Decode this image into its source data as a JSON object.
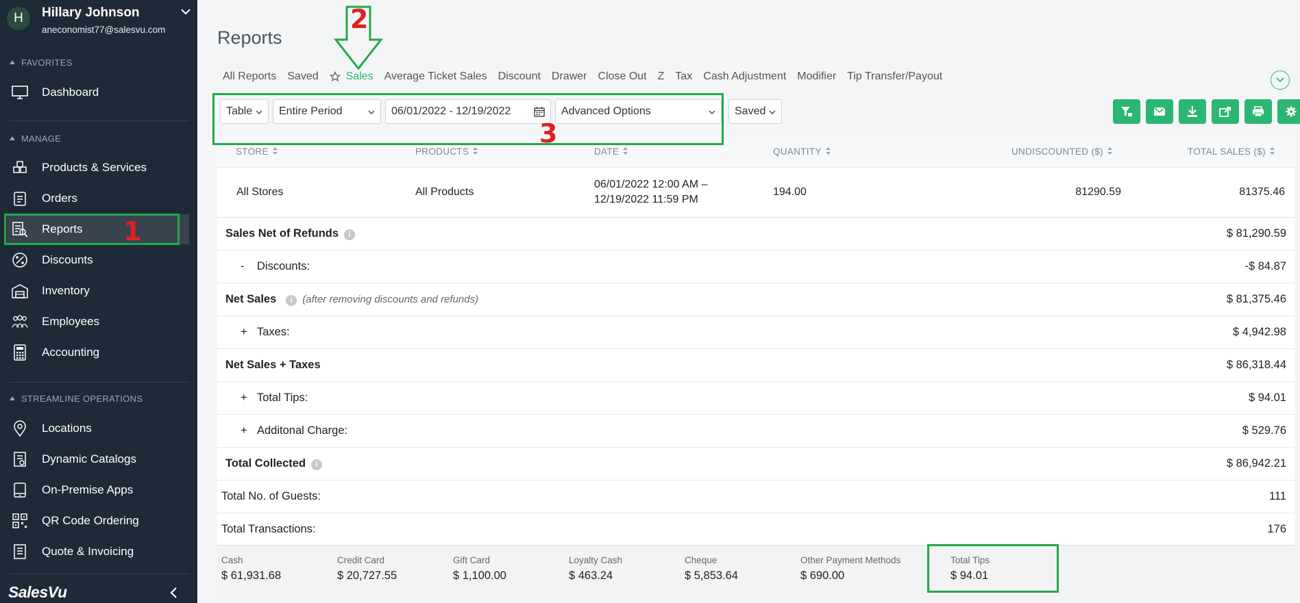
{
  "user": {
    "initial": "H",
    "name": "Hillary Johnson",
    "email": "aneconomist77@salesvu.com"
  },
  "sidebar": {
    "sections": {
      "favorites": "FAVORITES",
      "manage": "MANAGE",
      "streamline": "STREAMLINE OPERATIONS"
    },
    "favorites": [
      {
        "label": "Dashboard",
        "icon": "monitor-icon"
      }
    ],
    "manage": [
      {
        "label": "Products & Services",
        "icon": "boxes-icon"
      },
      {
        "label": "Orders",
        "icon": "clipboard-icon"
      },
      {
        "label": "Reports",
        "icon": "report-icon"
      },
      {
        "label": "Discounts",
        "icon": "percent-icon"
      },
      {
        "label": "Inventory",
        "icon": "warehouse-icon"
      },
      {
        "label": "Employees",
        "icon": "people-icon"
      },
      {
        "label": "Accounting",
        "icon": "calculator-icon"
      }
    ],
    "streamline": [
      {
        "label": "Locations",
        "icon": "location-pin-icon"
      },
      {
        "label": "Dynamic Catalogs",
        "icon": "catalog-icon"
      },
      {
        "label": "On-Premise Apps",
        "icon": "apps-icon"
      },
      {
        "label": "QR Code Ordering",
        "icon": "qr-code-icon"
      },
      {
        "label": "Quote & Invoicing",
        "icon": "invoice-icon"
      }
    ],
    "brand": "SalesVu"
  },
  "page": {
    "title": "Reports"
  },
  "tabs": [
    "All Reports",
    "Saved",
    "Sales",
    "Average Ticket Sales",
    "Discount",
    "Drawer",
    "Close Out",
    "Z",
    "Tax",
    "Cash Adjustment",
    "Modifier",
    "Tip Transfer/Payout"
  ],
  "active_tab": "Sales",
  "toolbar": {
    "view": "Table",
    "period": "Entire Period",
    "date_range": "06/01/2022 - 12/19/2022",
    "advanced": "Advanced Options",
    "saved": "Saved"
  },
  "actions": [
    "filter-icon",
    "email-icon",
    "download-icon",
    "share-icon",
    "print-icon",
    "settings-icon"
  ],
  "table": {
    "headers": [
      "STORE",
      "PRODUCTS",
      "DATE",
      "QUANTITY",
      "UNDISCOUNTED ($)",
      "TOTAL SALES ($)"
    ],
    "row": {
      "store": "All Stores",
      "products": "All Products",
      "date_line1": "06/01/2022 12:00 AM –",
      "date_line2": "12/19/2022 11:59 PM",
      "quantity": "194.00",
      "undiscounted": "81290.59",
      "total_sales": "81375.46"
    }
  },
  "summary": [
    {
      "label": "Sales Net of Refunds",
      "value": "$ 81,290.59"
    },
    {
      "op": "-",
      "label": "Discounts:",
      "value": "-$ 84.87"
    },
    {
      "label": "Net Sales",
      "note": "(after removing discounts and refunds)",
      "value": "$ 81,375.46"
    },
    {
      "op": "+",
      "label": "Taxes:",
      "value": "$ 4,942.98"
    },
    {
      "label": "Net Sales + Taxes",
      "value": "$ 86,318.44"
    },
    {
      "op": "+",
      "label": "Total Tips:",
      "value": "$ 94.01"
    },
    {
      "op": "+",
      "label": "Additonal Charge:",
      "value": "$ 529.76"
    },
    {
      "label": "Total Collected",
      "value": "$ 86,942.21"
    },
    {
      "label": "Total No. of Guests:",
      "value": "111"
    },
    {
      "label": "Total Transactions:",
      "value": "176"
    }
  ],
  "payments": [
    {
      "label": "Cash",
      "value": "$ 61,931.68"
    },
    {
      "label": "Credit Card",
      "value": "$ 20,727.55"
    },
    {
      "label": "Gift Card",
      "value": "$ 1,100.00"
    },
    {
      "label": "Loyalty Cash",
      "value": "$ 463.24"
    },
    {
      "label": "Cheque",
      "value": "$ 5,853.64"
    },
    {
      "label": "Other Payment Methods",
      "value": "$ 690.00"
    },
    {
      "label": "Total Tips",
      "value": "$ 94.01"
    }
  ],
  "annotations": {
    "n1": "1",
    "n2": "2",
    "n3": "3",
    "color": "#22a84a",
    "num_color": "#e02020"
  },
  "colors": {
    "accent": "#2bb673",
    "sidebar_bg": "#1e2a38"
  }
}
